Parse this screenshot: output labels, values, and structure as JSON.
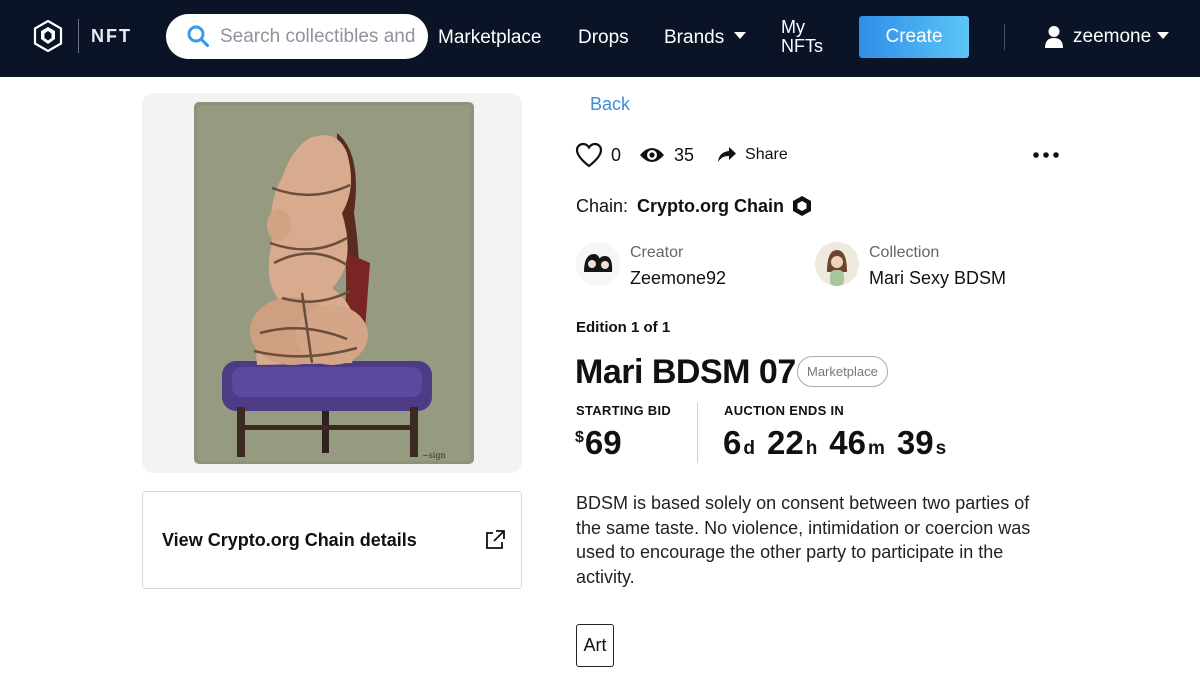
{
  "nav": {
    "brand_label": "NFT",
    "search_placeholder": "Search collectibles and",
    "links": {
      "marketplace": "Marketplace",
      "drops": "Drops",
      "brands": "Brands",
      "my_nfts": "My NFTs"
    },
    "create_label": "Create",
    "username": "zeemone",
    "accent_color": "#3b9ae8",
    "bar_color": "#0b1426"
  },
  "details_card": {
    "label": "View Crypto.org Chain details"
  },
  "item": {
    "back_label": "Back",
    "likes": "0",
    "views": "35",
    "share_label": "Share",
    "chain_label": "Chain:",
    "chain_name": "Crypto.org Chain",
    "creator": {
      "role": "Creator",
      "name": "Zeemone92"
    },
    "collection": {
      "role": "Collection",
      "name": "Mari Sexy BDSM"
    },
    "edition": "Edition 1 of 1",
    "title": "Mari BDSM 07",
    "badge": "Marketplace",
    "starting_bid_label": "STARTING BID",
    "currency": "$",
    "starting_bid": "69",
    "auction_label": "AUCTION ENDS IN",
    "countdown": {
      "days": "6",
      "hours": "22",
      "minutes": "46",
      "seconds": "39",
      "d": "d",
      "h": "h",
      "m": "m",
      "s": "s"
    },
    "description": "BDSM is based solely on consent between two parties of the same taste. No violence, intimidation or coercion was used to encourage the other party to participate in the activity.",
    "tag": "Art"
  }
}
